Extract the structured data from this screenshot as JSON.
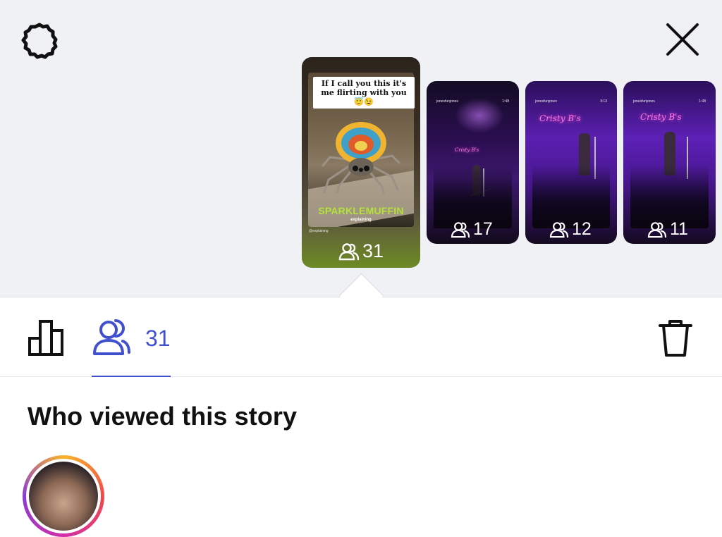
{
  "app": {
    "screen": "story-viewers"
  },
  "icons": {
    "settings": "gear-icon",
    "close": "close-icon",
    "stats": "bar-chart-icon",
    "viewers": "people-icon",
    "delete": "trash-icon"
  },
  "stories": [
    {
      "id": "story-1",
      "selected": true,
      "viewers": "31",
      "caption": "If I call you this it's me flirting with you 😇😉",
      "headline": "SPARKLEMUFFIN",
      "brand": "explaining",
      "handle": "@explaining"
    },
    {
      "id": "story-2",
      "selected": false,
      "viewers": "17",
      "handle": "jonesfunjones",
      "time": "1:48",
      "neon": "Cristy B's"
    },
    {
      "id": "story-3",
      "selected": false,
      "viewers": "12",
      "handle": "jonesfunjones",
      "time": "3:13",
      "neon": "Cristy B's"
    },
    {
      "id": "story-4",
      "selected": false,
      "viewers": "11",
      "handle": "jonesfunjones",
      "time": "1:48",
      "neon": "Cristy B's"
    }
  ],
  "tabs": {
    "viewers_count": "31",
    "active": "viewers"
  },
  "section": {
    "title": "Who viewed this story"
  },
  "colors": {
    "accent": "#4150cf",
    "top_background": "#f0f1f4",
    "headline_green": "#b4e23a",
    "neon_pink": "#ff7be3"
  }
}
